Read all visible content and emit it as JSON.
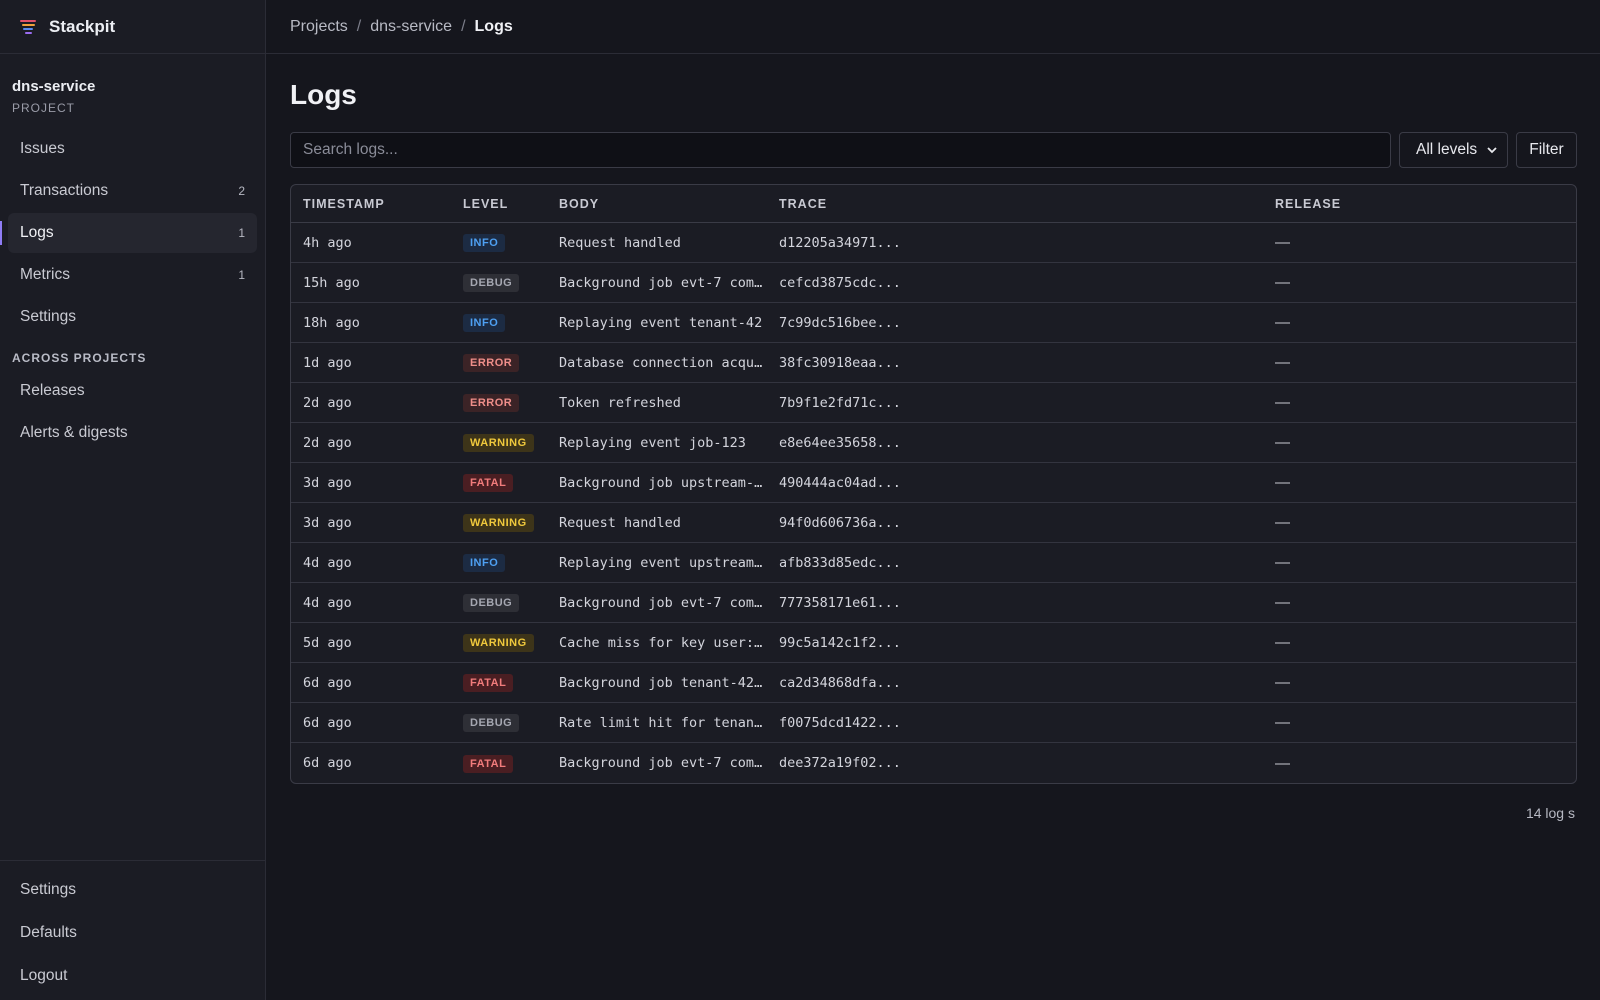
{
  "brand": {
    "name": "Stackpit"
  },
  "project": {
    "name": "dns-service",
    "label": "PROJECT"
  },
  "nav": [
    {
      "label": "Issues",
      "count": ""
    },
    {
      "label": "Transactions",
      "count": "2"
    },
    {
      "label": "Logs",
      "count": "1",
      "active": true
    },
    {
      "label": "Metrics",
      "count": "1"
    },
    {
      "label": "Settings",
      "count": ""
    }
  ],
  "across": {
    "label": "ACROSS PROJECTS",
    "items": [
      "Releases",
      "Alerts & digests"
    ]
  },
  "bottom_nav": [
    "Settings",
    "Defaults",
    "Logout"
  ],
  "breadcrumb": [
    "Projects",
    "dns-service",
    "Logs"
  ],
  "breadcrumb_sep": "/",
  "page": {
    "title": "Logs"
  },
  "search": {
    "placeholder": "Search logs...",
    "value": ""
  },
  "level_select": {
    "value": "All levels",
    "chevron": "⌄"
  },
  "filter_button": "Filter",
  "table": {
    "headers": [
      "TIMESTAMP",
      "LEVEL",
      "BODY",
      "TRACE",
      "RELEASE"
    ],
    "rows": [
      {
        "ts": "4h ago",
        "level": "INFO",
        "body": "Request handled",
        "trace": "d12205a34971...",
        "release": "—"
      },
      {
        "ts": "15h ago",
        "level": "DEBUG",
        "body": "Background job evt-7 com…",
        "trace": "cefcd3875cdc...",
        "release": "—"
      },
      {
        "ts": "18h ago",
        "level": "INFO",
        "body": "Replaying event tenant-42",
        "trace": "7c99dc516bee...",
        "release": "—"
      },
      {
        "ts": "1d ago",
        "level": "ERROR",
        "body": "Database connection acqu…",
        "trace": "38fc30918eaa...",
        "release": "—"
      },
      {
        "ts": "2d ago",
        "level": "ERROR",
        "body": "Token refreshed",
        "trace": "7b9f1e2fd71c...",
        "release": "—"
      },
      {
        "ts": "2d ago",
        "level": "WARNING",
        "body": "Replaying event job-123",
        "trace": "e8e64ee35658...",
        "release": "—"
      },
      {
        "ts": "3d ago",
        "level": "FATAL",
        "body": "Background job upstream-…",
        "trace": "490444ac04ad...",
        "release": "—"
      },
      {
        "ts": "3d ago",
        "level": "WARNING",
        "body": "Request handled",
        "trace": "94f0d606736a...",
        "release": "—"
      },
      {
        "ts": "4d ago",
        "level": "INFO",
        "body": "Replaying event upstream…",
        "trace": "afb833d85edc...",
        "release": "—"
      },
      {
        "ts": "4d ago",
        "level": "DEBUG",
        "body": "Background job evt-7 com…",
        "trace": "777358171e61...",
        "release": "—"
      },
      {
        "ts": "5d ago",
        "level": "WARNING",
        "body": "Cache miss for key user:…",
        "trace": "99c5a142c1f2...",
        "release": "—"
      },
      {
        "ts": "6d ago",
        "level": "FATAL",
        "body": "Background job tenant-42…",
        "trace": "ca2d34868dfa...",
        "release": "—"
      },
      {
        "ts": "6d ago",
        "level": "DEBUG",
        "body": "Rate limit hit for tenan…",
        "trace": "f0075dcd1422...",
        "release": "—"
      },
      {
        "ts": "6d ago",
        "level": "FATAL",
        "body": "Background job evt-7 com…",
        "trace": "dee372a19f02...",
        "release": "—"
      }
    ]
  },
  "footer": {
    "count_text": "14 log s"
  },
  "colors": {
    "accent": "#8f7cf5",
    "info": "#4ea0f2",
    "debug": "#a5a7b1",
    "error": "#f08f8a",
    "warning": "#f0c93c",
    "fatal": "#f27c7c"
  }
}
